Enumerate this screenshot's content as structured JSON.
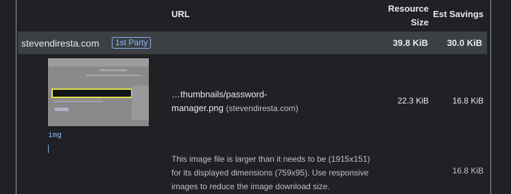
{
  "header": {
    "url": "URL",
    "resource_size": "Resource Size",
    "est_savings": "Est Savings"
  },
  "group": {
    "host": "stevendiresta.com",
    "badge": "1st Party",
    "resource_size": "39.8 KiB",
    "est_savings": "30.0 KiB"
  },
  "item": {
    "node_tag": "img",
    "url_text": "…thumbnails/password-manager.png",
    "origin": "(stevendiresta.com)",
    "resource_size": "22.3 KiB",
    "est_savings": "16.8 KiB",
    "description": "This image file is larger than it needs to be (1915x151) for its displayed dimensions (759x95). Use responsive images to reduce the image download size.",
    "description_savings": "16.8 KiB"
  },
  "colors": {
    "background": "#202124",
    "row_highlight": "#3c4043",
    "accent": "#8ab4f8",
    "thumbnail_highlight": "#e6e34a"
  }
}
